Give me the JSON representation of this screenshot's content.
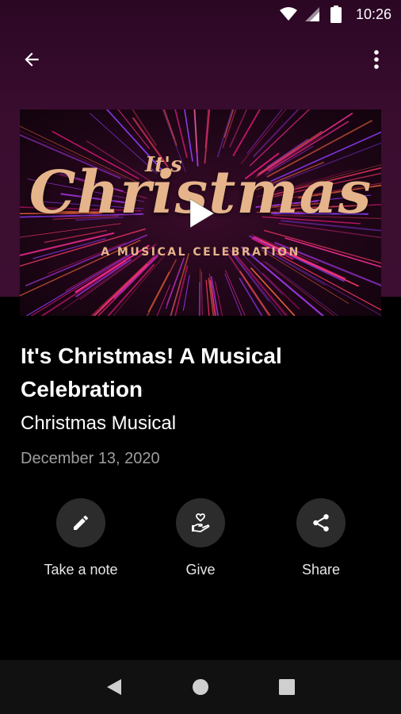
{
  "status_bar": {
    "time": "10:26",
    "icons": [
      "wifi-icon",
      "cell-signal-icon",
      "battery-icon"
    ]
  },
  "app_bar": {
    "back_icon": "arrow-left-icon",
    "menu_icon": "more-vert-icon"
  },
  "video": {
    "artwork_title_prefix": "It's",
    "artwork_title": "Christmas",
    "artwork_subtitle": "A MUSICAL CELEBRATION",
    "play_icon": "play-icon"
  },
  "sermon": {
    "title": "It's Christmas! A Musical Celebration",
    "series": "Christmas Musical",
    "date": "December 13, 2020"
  },
  "actions": [
    {
      "label": "Take a note",
      "icon": "pencil-icon"
    },
    {
      "label": "Give",
      "icon": "give-hand-heart-icon"
    },
    {
      "label": "Share",
      "icon": "share-icon"
    }
  ],
  "nav_bar": {
    "icons": [
      "back-triangle-icon",
      "home-circle-icon",
      "recents-square-icon"
    ]
  },
  "colors": {
    "header_background": "#3d0e31",
    "background": "#000000",
    "artwork_text": "#e6b48a",
    "date_text": "#9e9e9e",
    "action_circle": "#2c2c2c"
  }
}
